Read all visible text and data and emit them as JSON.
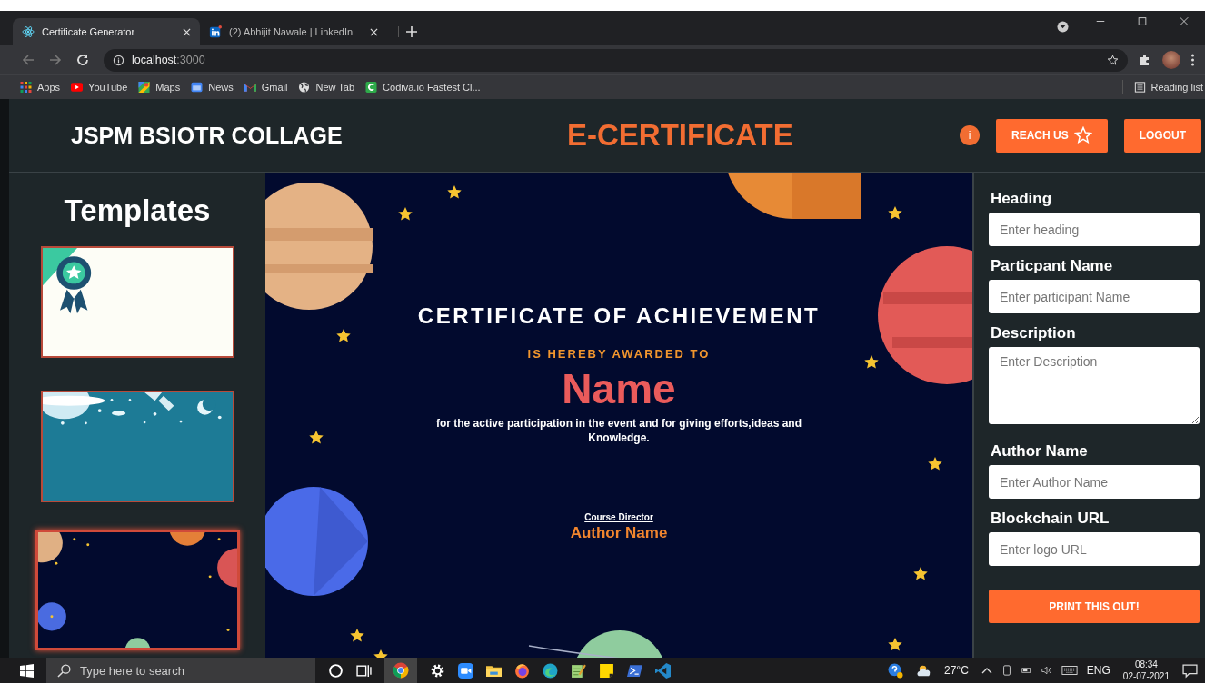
{
  "browser": {
    "tabs": [
      {
        "title": "Certificate Generator",
        "selected": true,
        "kind": "react"
      },
      {
        "title": "(2) Abhijit Nawale | LinkedIn",
        "selected": false,
        "kind": "linkedin"
      }
    ],
    "address": {
      "host": "localhost",
      "port": ":3000"
    },
    "bookmarks": [
      {
        "label": "Apps",
        "kind": "grid"
      },
      {
        "label": "YouTube",
        "kind": "video"
      },
      {
        "label": "Maps",
        "kind": "map"
      },
      {
        "label": "News",
        "kind": "news"
      },
      {
        "label": "Gmail",
        "kind": "mail"
      },
      {
        "label": "New Tab",
        "kind": "globe"
      },
      {
        "label": "Codiva.io Fastest Cl...",
        "kind": "letter"
      }
    ],
    "reading_list": "Reading list"
  },
  "header": {
    "brand": "JSPM BSIOTR COLLAGE",
    "title": "E-CERTIFICATE",
    "info_badge": "i",
    "buttons": [
      {
        "label": "REACH US",
        "kind": "star"
      },
      {
        "label": "LOGOUT",
        "kind": "plain"
      }
    ]
  },
  "sidebar": {
    "title": "Templates",
    "templates": [
      {
        "kind": "ribbon",
        "selected": false
      },
      {
        "kind": "space-teal",
        "selected": false
      },
      {
        "kind": "space-navy",
        "selected": true
      }
    ]
  },
  "certificate": {
    "heading": "CERTIFICATE OF ACHIEVEMENT",
    "subheading": "IS HEREBY AWARDED TO",
    "name": "Name",
    "description": "for the active participation in the event and for giving efforts,ideas and Knowledge.",
    "signature_title": "Course Director",
    "author": "Author Name"
  },
  "form": {
    "fields": [
      {
        "label": "Heading",
        "placeholder": "Enter heading",
        "kind": "input"
      },
      {
        "label": "Particpant Name",
        "placeholder": "Enter participant Name",
        "kind": "input"
      },
      {
        "label": "Description",
        "placeholder": "Enter Description",
        "kind": "textarea"
      },
      {
        "label": "Author Name",
        "placeholder": "Enter Author Name",
        "kind": "input"
      },
      {
        "label": "Blockchain URL",
        "placeholder": "Enter logo URL",
        "kind": "input"
      }
    ],
    "submit": "PRINT THIS OUT!"
  },
  "taskbar": {
    "search_placeholder": "Type here to search",
    "temperature": "27°C",
    "language": "ENG",
    "time": "08:34",
    "date": "02-07-2021"
  }
}
